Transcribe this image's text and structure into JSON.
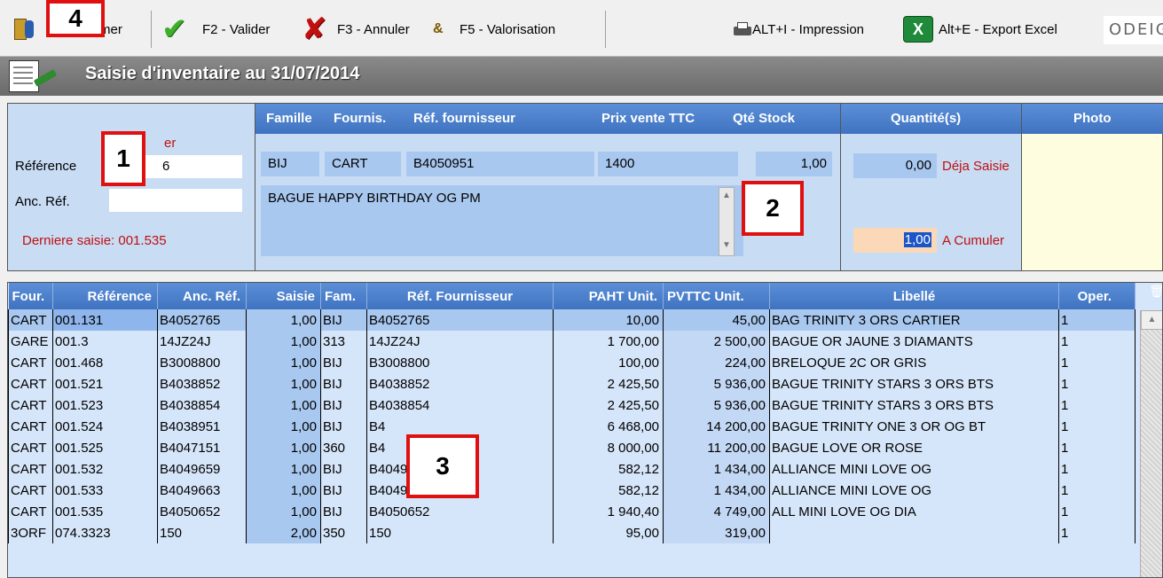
{
  "toolbar": {
    "exit_label": "Fermer",
    "exit_visible": "mer",
    "validate_label": "F2 - Valider",
    "cancel_label": "F3 - Annuler",
    "valuation_label": "F5 - Valorisation",
    "print_label": "ALT+I - Impression",
    "export_label": "Alt+E - Export Excel",
    "logo_text": "ODEIG"
  },
  "title": "Saisie d'inventaire au 31/07/2014",
  "left_panel": {
    "reference_label": "Référence",
    "reference_value": "6",
    "red_hint": "er",
    "old_ref_label": "Anc. Réf.",
    "old_ref_value": "",
    "last_entry": "Derniere saisie: 001.535"
  },
  "detail": {
    "headers": [
      "Famille",
      "Fournis.",
      "Réf. fournisseur",
      "Prix vente TTC",
      "Qté Stock"
    ],
    "famille": "BIJ",
    "fournis": "CART",
    "ref_fournisseur": "B4050951",
    "prix_vente": "1400",
    "qte_stock": "1,00",
    "description": "BAGUE HAPPY BIRTHDAY OG PM"
  },
  "quantity": {
    "header": "Quantité(s)",
    "already_value": "0,00",
    "already_label": "Déja Saisie",
    "cumulate_value": "1,00",
    "cumulate_label": "A Cumuler"
  },
  "photo": {
    "header": "Photo"
  },
  "table": {
    "columns": [
      "Four.",
      "Référence",
      "Anc. Réf.",
      "Saisie",
      "Fam.",
      "Réf. Fournisseur",
      "PAHT Unit.",
      "PVTTC Unit.",
      "Libellé",
      "Oper."
    ],
    "rows": [
      [
        "CART",
        "001.131",
        "B4052765",
        "1,00",
        "BIJ",
        "B4052765",
        "10,00",
        "45,00",
        "BAG TRINITY 3 ORS CARTIER",
        "1"
      ],
      [
        "GARE",
        "001.3",
        "14JZ24J",
        "1,00",
        "313",
        "14JZ24J",
        "1 700,00",
        "2 500,00",
        "BAGUE OR JAUNE 3 DIAMANTS",
        "1"
      ],
      [
        "CART",
        "001.468",
        "B3008800",
        "1,00",
        "BIJ",
        "B3008800",
        "100,00",
        "224,00",
        "BRELOQUE 2C OR GRIS",
        "1"
      ],
      [
        "CART",
        "001.521",
        "B4038852",
        "1,00",
        "BIJ",
        "B4038852",
        "2 425,50",
        "5 936,00",
        "BAGUE TRINITY STARS 3 ORS BTS",
        "1"
      ],
      [
        "CART",
        "001.523",
        "B4038854",
        "1,00",
        "BIJ",
        "B4038854",
        "2 425,50",
        "5 936,00",
        "BAGUE TRINITY STARS 3 ORS BTS",
        "1"
      ],
      [
        "CART",
        "001.524",
        "B4038951",
        "1,00",
        "BIJ",
        "B4",
        "6 468,00",
        "14 200,00",
        "BAGUE TRINITY ONE 3 OR OG BT",
        "1"
      ],
      [
        "CART",
        "001.525",
        "B4047151",
        "1,00",
        "360",
        "B4",
        "8 000,00",
        "11 200,00",
        "BAGUE LOVE OR ROSE",
        "1"
      ],
      [
        "CART",
        "001.532",
        "B4049659",
        "1,00",
        "BIJ",
        "B4049659",
        "582,12",
        "1 434,00",
        "ALLIANCE MINI LOVE OG",
        "1"
      ],
      [
        "CART",
        "001.533",
        "B4049663",
        "1,00",
        "BIJ",
        "B4049663",
        "582,12",
        "1 434,00",
        "ALLIANCE MINI LOVE OG",
        "1"
      ],
      [
        "CART",
        "001.535",
        "B4050652",
        "1,00",
        "BIJ",
        "B4050652",
        "1 940,40",
        "4 749,00",
        "ALL MINI LOVE OG DIA",
        "1"
      ],
      [
        "3ORF",
        "074.3323",
        "150",
        "2,00",
        "350",
        "150",
        "95,00",
        "319,00",
        "",
        "1"
      ]
    ]
  },
  "callouts": [
    "1",
    "2",
    "3",
    "4"
  ],
  "colors": {
    "header_blue": "#3f73c0",
    "panel_blue": "#c8dcf4",
    "callout_red": "#e01010",
    "label_red": "#c01010"
  }
}
